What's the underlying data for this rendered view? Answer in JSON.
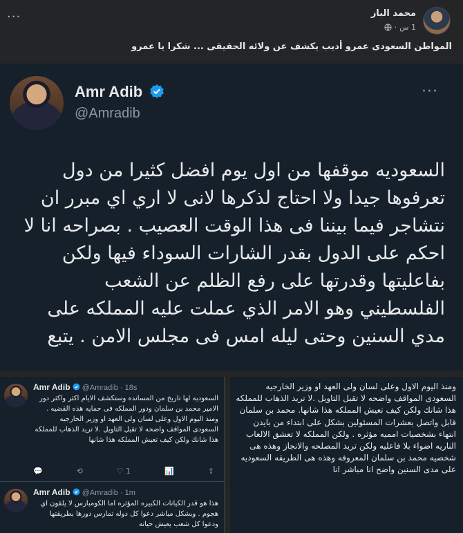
{
  "post": {
    "author": "محمد الباز",
    "time": "1 س",
    "more": "···",
    "caption": "المواطن السعودى عمرو  أديب يكشف عن ولائه الحقيقى ... شكرا يا عمرو"
  },
  "main_tweet": {
    "name": "Amr Adib",
    "handle": "@Amradib",
    "more": "···",
    "text": "السعوديه موقفها من اول يوم افضل كثيرا من دول تعرفوها جيدا ولا احتاج لذكرها لانى لا اري اي مبرر ان نتشاجر فيما بيننا فى هذا الوقت العصيب . بصراحه انا لا احكم على الدول بقدر الشارات السوداء فيها ولكن بفاعليتها  وقدرتها على رفع الظلم عن الشعب الفلسطيني وهو الامر الذي عملت عليه المملكه على مدي السنين وحتى ليله امس فى مجلس الامن . يتبع"
  },
  "left_card": {
    "tweets": [
      {
        "name": "Amr Adib",
        "handle": "@Amradib",
        "time": "· 18s",
        "text": "السعوديه لها تاريخ من المسانده وستكشف  الايام اكثر واكثر دور الامير محمد بن سلمان ودور المملكه فى حمايه هذه القضيه . ومنذ اليوم الاول وعلى لسان ولى العهد او وزير الخارجيه السعودى المواقف واضحه لا تقبل التاويل .لا تريد الذهاب للمملكه هذا شانك ولكن كيف تعيش المملكه هذا شانها",
        "actions": [
          "💬",
          "⟲",
          "♡ 1",
          "📊",
          "⇪"
        ]
      },
      {
        "name": "Amr Adib",
        "handle": "@Amradib",
        "time": "· 1m",
        "text": "هذا هو قدر الكيانات الكبيره المؤثره اما الكومبارس لا يلقون اي هجوم  . وبشكل مباشر دعوا كل دوله تمارس دورها بطريقتها ودعوا كل شعب يعيش حياته"
      }
    ]
  },
  "right_card": {
    "text": "ومنذ اليوم الاول وعلى لسان ولى العهد او وزير الخارجيه السعودى المواقف واضحه لا تقبل التاويل .لا تريد الذهاب للمملكه هذا شانك ولكن كيف تعيش المملكه هذا شانها. محمد بن سلمان قابل واتصل بعشرات المسئولين بشكل على ابتداء من بايدن انتهاء بشخصيات امميه مؤثره .  ولكن المملكه لا تعشق الالعاب الناريه اضواء بلا فاعليه ولكن تريد المصلحه والانجاز وهذه هى شخصيه محمد بن سلمان المعروفه وهذه هى الطريقه السعوديه على مدى السنين واضح انا مباشر انا"
  },
  "colors": {
    "fb_bg": "#242526",
    "tw_bg": "#15202b",
    "verified": "#1d9bf0"
  }
}
